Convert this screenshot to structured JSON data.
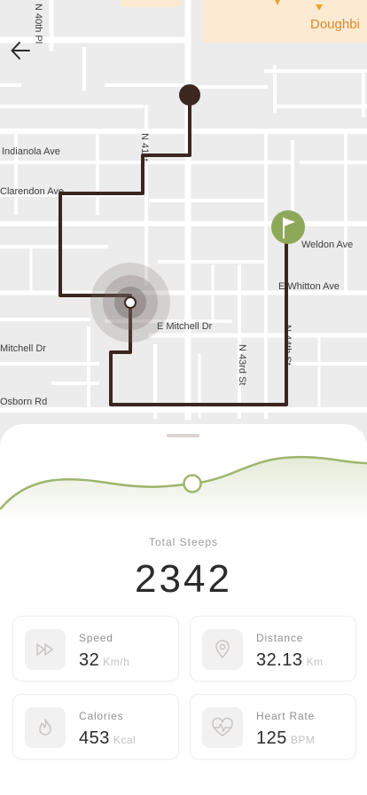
{
  "map": {
    "streets": [
      "Indianola Ave",
      "Clarendon Ave",
      "E Mitchell Dr",
      "Mitchell Dr",
      "Osborn Rd",
      "N 40th Pl",
      "N 41st",
      "N 43rd St",
      "N 44th St",
      "Weldon Ave",
      "E Whitton Ave"
    ],
    "poi": "Doughbi"
  },
  "stats": {
    "total_label": "Total Steeps",
    "total_value": "2342",
    "cards": [
      {
        "label": "Speed",
        "value": "32",
        "unit": "Km/h",
        "icon": "fast-forward-icon"
      },
      {
        "label": "Distance",
        "value": "32.13",
        "unit": "Km",
        "icon": "location-pin-icon"
      },
      {
        "label": "Calories",
        "value": "453",
        "unit": "Kcal",
        "icon": "flame-icon"
      },
      {
        "label": "Heart Rate",
        "value": "125",
        "unit": "BPM",
        "icon": "heart-rate-icon"
      }
    ]
  },
  "colors": {
    "route": "#3b2620",
    "start_marker": "#3b2620",
    "finish_flag": "#8ea85a",
    "accent_green": "#9fb56e",
    "map_background": "#ececec",
    "poi_area": "#fcebd2"
  }
}
